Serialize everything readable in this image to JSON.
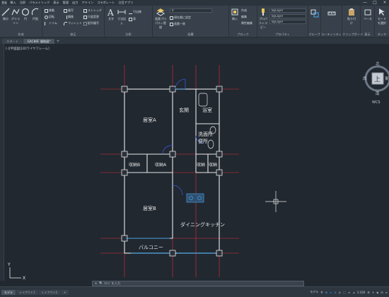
{
  "menu": {
    "items": [
      "ﾎｰﾑ",
      "挿入",
      "注釈",
      "パラメトリック",
      "表示",
      "管理",
      "出力",
      "アドイン",
      "コラボレート",
      "注目アプリ"
    ],
    "active_index": 0
  },
  "window_controls": [
    "—",
    "□",
    "×"
  ],
  "ribbon": {
    "panels": {
      "draw": {
        "label": "作成",
        "big_tools": [
          "線分",
          "ポリライン",
          "円",
          "円弧"
        ]
      },
      "modify": {
        "label": "修正",
        "tools": [
          "移動",
          "回転",
          "トリム",
          "複写",
          "鏡像",
          "フィレット",
          "ストレッチ",
          "尺度変更",
          "配列複写"
        ]
      },
      "annotation": {
        "label": "注釈",
        "big_tools": [
          "文字",
          "寸法記入"
        ],
        "tools": [
          "引出線",
          "表"
        ]
      },
      "layers": {
        "label": "画層",
        "big_tools": [
          "画層プロパティ管理"
        ],
        "combo": "0",
        "tools": [
          "現在層に設定",
          "画層一致"
        ]
      },
      "block": {
        "label": "ブロック",
        "big_tools": [
          "挿入"
        ],
        "tools": [
          "作成",
          "編集",
          "属性編集"
        ]
      },
      "properties": {
        "label": "プロパティ",
        "big_tools": [
          "プロパティコピー"
        ],
        "combos": [
          "ByLayer",
          "ByLayer",
          "ByLayer"
        ]
      },
      "groups": {
        "label": "グループ"
      },
      "utilities": {
        "label": "ユーティリティ"
      },
      "clipboard": {
        "label": "クリップボード",
        "big_tools": [
          "貼り付け"
        ]
      },
      "view": {
        "label": "表示",
        "big_tools": [
          "ベース"
        ]
      },
      "touch": {
        "label": "タッチ",
        "big_tools": [
          "モードを選択"
        ]
      }
    }
  },
  "file_tabs": {
    "items": [
      "スタート",
      "GAC86F 間取図*"
    ],
    "active_index": 1
  },
  "viewport_label": "[-][平面図][2Dワイヤフレーム]",
  "viewcube": {
    "top": "上",
    "north": "北",
    "south": "南",
    "east": "東",
    "west": "西",
    "wcs": "WCS"
  },
  "floor_plan": {
    "rooms": [
      {
        "name": "居室A"
      },
      {
        "name": "玄関"
      },
      {
        "name": "浴室"
      },
      {
        "name": "洗面所\n便所"
      },
      {
        "name": "収納B"
      },
      {
        "name": "収納A"
      },
      {
        "name": "収納"
      },
      {
        "name": "収納"
      },
      {
        "name": "居室B"
      },
      {
        "name": "ダイニングキッチン"
      },
      {
        "name": "バルコニー"
      }
    ],
    "colors": {
      "wall": "#e8e8e8",
      "grid_line": "#e0303a",
      "door": "#3a58d8",
      "sink": "#4aa0e0",
      "crosshair": "#e8e8e8"
    }
  },
  "ucs": {
    "x_label": "X",
    "y_label": "Y"
  },
  "command_line": {
    "placeholder": "ｺﾏﾝﾄﾞを入力",
    "buttons": [
      "×",
      "🔍"
    ]
  },
  "layout_tabs": {
    "items": [
      "モデル",
      "レイアウト1",
      "レイアウト2",
      "+"
    ],
    "active_index": 0
  },
  "status": {
    "items": [
      "モデル",
      "#",
      "⊞",
      "↳",
      "⊙",
      "∠",
      "⬚",
      "≡",
      "⊿",
      "1:100",
      "⚙",
      "+",
      "◈",
      "⊟",
      "≡"
    ],
    "on_indices": [
      2,
      3,
      4
    ]
  }
}
